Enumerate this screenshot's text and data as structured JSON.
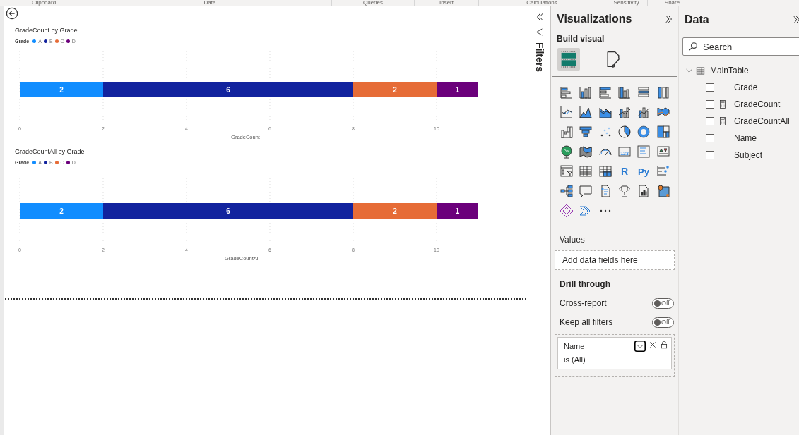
{
  "ribbon": {
    "groups": [
      "Clipboard",
      "Data",
      "Queries",
      "Insert",
      "Calculations",
      "Sensitivity",
      "Share"
    ]
  },
  "charts": [
    {
      "title": "GradeCount by Grade",
      "legend_title": "Grade",
      "chart_data": {
        "type": "bar",
        "orientation": "horizontal",
        "stacked": true,
        "grid": true,
        "xlabel": "GradeCount",
        "xlim": [
          0,
          11
        ],
        "xticks": [
          0,
          2,
          4,
          6,
          8,
          10
        ],
        "data_labels": true,
        "series": [
          {
            "name": "A",
            "color": "#118dff",
            "values": [
              2
            ]
          },
          {
            "name": "B",
            "color": "#12239e",
            "values": [
              6
            ]
          },
          {
            "name": "C",
            "color": "#e66c37",
            "values": [
              2
            ]
          },
          {
            "name": "D",
            "color": "#6b007b",
            "values": [
              1
            ]
          }
        ]
      }
    },
    {
      "title": "GradeCountAll by Grade",
      "legend_title": "Grade",
      "chart_data": {
        "type": "bar",
        "orientation": "horizontal",
        "stacked": true,
        "grid": true,
        "xlabel": "GradeCountAll",
        "xlim": [
          0,
          11
        ],
        "xticks": [
          0,
          2,
          4,
          6,
          8,
          10
        ],
        "data_labels": true,
        "series": [
          {
            "name": "A",
            "color": "#118dff",
            "values": [
              2
            ]
          },
          {
            "name": "B",
            "color": "#12239e",
            "values": [
              6
            ]
          },
          {
            "name": "C",
            "color": "#e66c37",
            "values": [
              2
            ]
          },
          {
            "name": "D",
            "color": "#6b007b",
            "values": [
              1
            ]
          }
        ]
      }
    }
  ],
  "filters_pane": {
    "title": "Filters"
  },
  "visualizations": {
    "title": "Visualizations",
    "subtitle": "Build visual",
    "view_toggle": [
      {
        "kind": "build",
        "selected": true
      },
      {
        "kind": "format",
        "selected": false
      }
    ],
    "gallery_glyphs": [
      "123",
      "R",
      "Py"
    ],
    "values": {
      "label": "Values",
      "placeholder": "Add data fields here"
    },
    "drill_through": {
      "title": "Drill through",
      "toggles": [
        {
          "label": "Cross-report",
          "on": false,
          "state_text": "Off"
        },
        {
          "label": "Keep all filters",
          "on": false,
          "state_text": "Off"
        }
      ]
    },
    "filter_card": {
      "field": "Name",
      "condition": "is (All)"
    }
  },
  "data_pane": {
    "title": "Data",
    "search": {
      "placeholder": "Search"
    },
    "tree": [
      {
        "label": "MainTable",
        "expanded": true,
        "children": [
          {
            "label": "Grade",
            "kind": "column",
            "checked": false
          },
          {
            "label": "GradeCount",
            "kind": "measure",
            "checked": false
          },
          {
            "label": "GradeCountAll",
            "kind": "measure",
            "checked": false
          },
          {
            "label": "Name",
            "kind": "column",
            "checked": false
          },
          {
            "label": "Subject",
            "kind": "column",
            "checked": false
          }
        ]
      }
    ]
  }
}
